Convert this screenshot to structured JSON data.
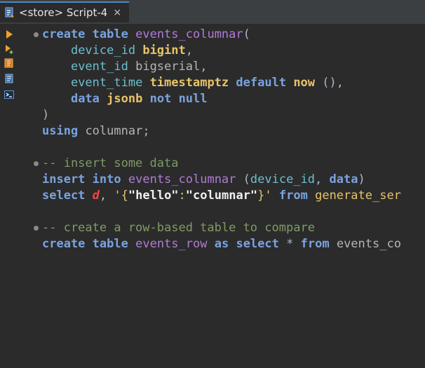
{
  "tab": {
    "title": "<store> Script-4",
    "close_glyph": "×",
    "icon": "sql-script-icon"
  },
  "toolbar": {
    "items": [
      {
        "name": "execute-statement-icon"
      },
      {
        "name": "execute-in-new-tab-icon"
      },
      {
        "name": "execute-script-icon"
      },
      {
        "name": "explain-plan-icon"
      },
      {
        "name": "console-icon"
      }
    ]
  },
  "code": {
    "line1": {
      "kw1": "create",
      "kw2": "table",
      "name": "events_columnar",
      "paren": "("
    },
    "line2": {
      "col": "device_id",
      "type": "bigint",
      "punct": ","
    },
    "line3": {
      "col": "event_id",
      "type": "bigserial",
      "punct": ","
    },
    "line4": {
      "col": "event_time",
      "type": "timestamptz",
      "kw": "default",
      "fn": "now",
      "rest": " (),"
    },
    "line5": {
      "col": "data",
      "type": "jsonb",
      "kw1": "not",
      "kw2": "null"
    },
    "line6": {
      "text": ")"
    },
    "line7": {
      "kw": "using",
      "ident": "columnar",
      "punct": ";"
    },
    "line9": {
      "comment": "-- insert some data"
    },
    "line10": {
      "kw1": "insert",
      "kw2": "into",
      "name": "events_columnar",
      "open": " (",
      "col": "device_id",
      "sep": ", ",
      "col2": "data",
      "close": ")"
    },
    "line11": {
      "kw": "select",
      "var": "d",
      "punct": ", ",
      "str_open": "'{",
      "key1": "\"hello\"",
      "colon": ":",
      "key2": "\"columnar\"",
      "str_close": "}'",
      "kw2": "from",
      "fn": "generate_ser"
    },
    "line13": {
      "comment": "-- create a row-based table to compare"
    },
    "line14": {
      "kw1": "create",
      "kw2": "table",
      "name": "events_row",
      "kw3": "as",
      "kw4": "select",
      "star": "*",
      "kw5": "from",
      "ident": "events_co"
    }
  },
  "colors": {
    "background": "#2b2b2b",
    "tabbar": "#3c3f41",
    "keyword": "#7aa3e0",
    "type": "#e8c46a",
    "table_name": "#b07cd8",
    "column": "#6cbfce",
    "comment": "#7e9c63",
    "variable": "#ff4040"
  }
}
